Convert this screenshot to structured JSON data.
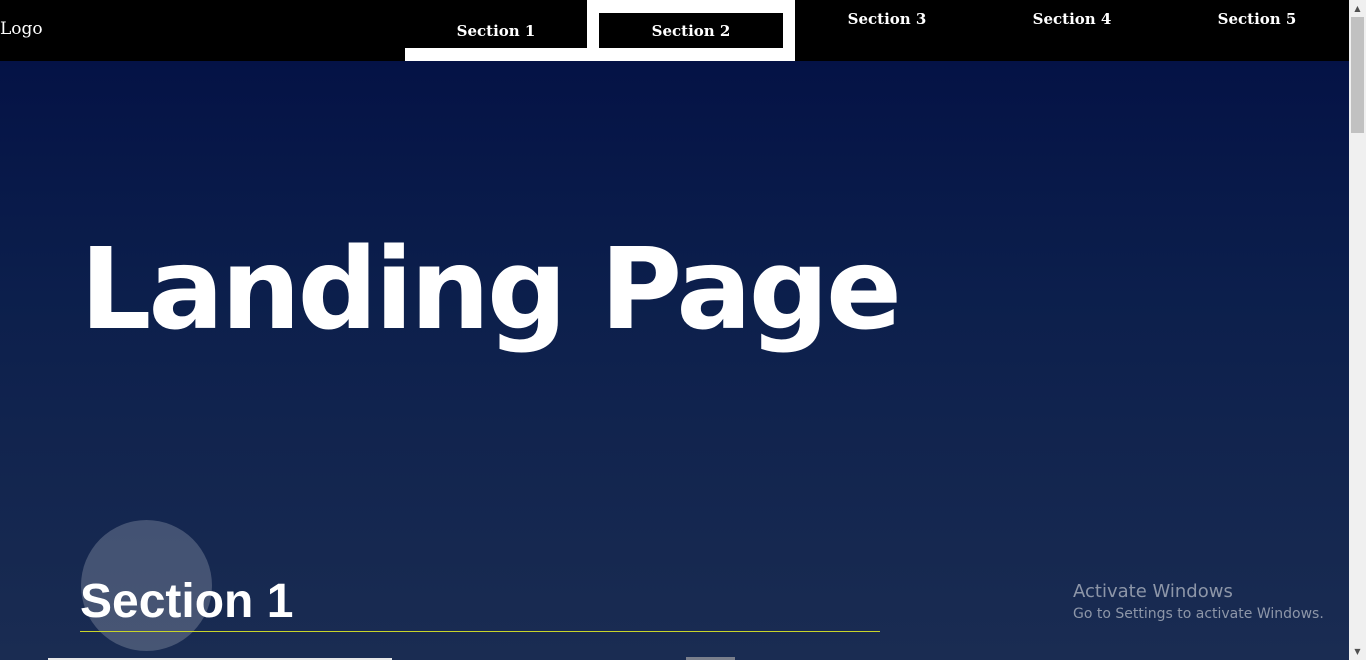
{
  "header": {
    "logo": "Logo",
    "nav": [
      {
        "label": "Section 1"
      },
      {
        "label": "Section 2"
      },
      {
        "label": "Section 3"
      },
      {
        "label": "Section 4"
      },
      {
        "label": "Section 5"
      }
    ]
  },
  "hero": {
    "title": "Landing Page"
  },
  "section": {
    "heading": "Section 1"
  },
  "watermark": {
    "title": "Activate Windows",
    "subtitle": "Go to Settings to activate Windows."
  },
  "scrollbar": {
    "up_icon": "triangle-up",
    "down_icon": "triangle-down"
  },
  "colors": {
    "navbar": "#000000",
    "hero_top": "#020f44",
    "hero_bottom": "#1a2c52",
    "heading_rule": "#c8d42a",
    "text": "#ffffff"
  }
}
